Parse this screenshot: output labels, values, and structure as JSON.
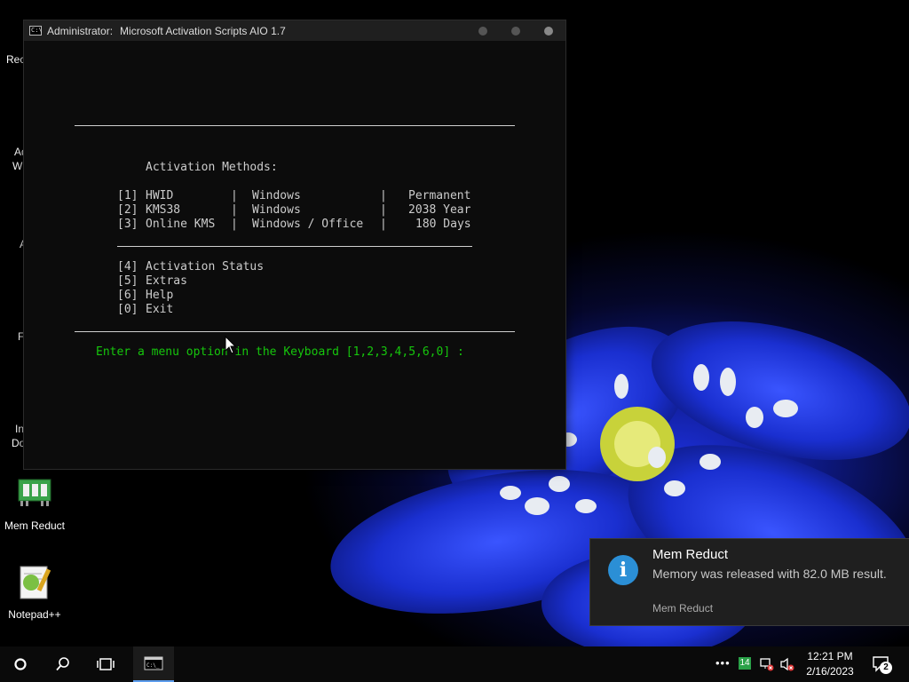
{
  "desktop": {
    "icons": [
      {
        "label": "Mem Reduct"
      },
      {
        "label": "Notepad++"
      }
    ],
    "partial_labels": [
      "Rec",
      "Ad",
      "W",
      "A",
      "F",
      "In",
      "Do"
    ]
  },
  "window": {
    "title_prefix": "Administrator:",
    "title": "Microsoft Activation Scripts AIO 1.7",
    "colors": {
      "background": "#0c0c0c",
      "text": "#cccccc",
      "prompt": "#16c60c"
    }
  },
  "console": {
    "heading": "Activation Methods:",
    "methods": [
      {
        "key": "[1]",
        "name": "HWID",
        "sep1": "|",
        "target": "Windows",
        "sep2": "|",
        "term": "Permanent"
      },
      {
        "key": "[2]",
        "name": "KMS38",
        "sep1": "|",
        "target": "Windows",
        "sep2": "|",
        "term": "2038 Year"
      },
      {
        "key": "[3]",
        "name": "Online KMS",
        "sep1": "|",
        "target": "Windows / Office",
        "sep2": "|",
        "term": "180 Days"
      }
    ],
    "options": [
      {
        "key": "[4]",
        "label": "Activation Status"
      },
      {
        "key": "[5]",
        "label": "Extras"
      },
      {
        "key": "[6]",
        "label": "Help"
      },
      {
        "key": "[0]",
        "label": "Exit"
      }
    ],
    "prompt": "Enter a menu option in the Keyboard [1,2,3,4,5,6,0] :"
  },
  "notification": {
    "title": "Mem Reduct",
    "body": "Memory was released with 82.0 MB result.",
    "source": "Mem Reduct",
    "icon": "info-icon",
    "accent": "#2b8fd6"
  },
  "taskbar": {
    "tray_badge": "14",
    "time": "12:21 PM",
    "date": "2/16/2023",
    "notification_count": "2"
  }
}
